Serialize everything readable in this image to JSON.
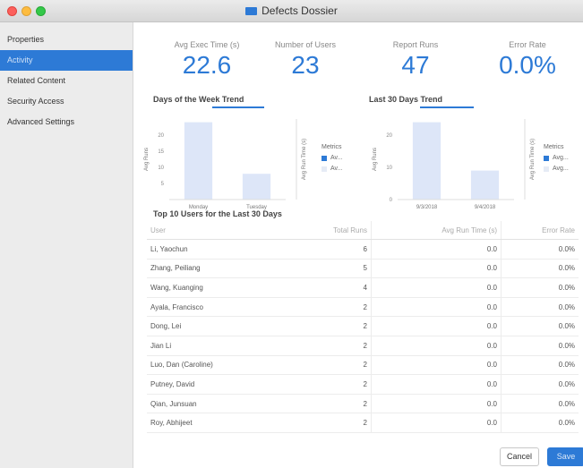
{
  "window": {
    "title": "Defects Dossier"
  },
  "sidebar": {
    "items": [
      {
        "label": "Properties"
      },
      {
        "label": "Activity"
      },
      {
        "label": "Related Content"
      },
      {
        "label": "Security Access"
      },
      {
        "label": "Advanced Settings"
      }
    ],
    "active_index": 1
  },
  "kpis": [
    {
      "label": "Avg Exec Time (s)",
      "value": "22.6"
    },
    {
      "label": "Number of Users",
      "value": "23"
    },
    {
      "label": "Report Runs",
      "value": "47"
    },
    {
      "label": "Error Rate",
      "value": "0.0%"
    }
  ],
  "charts": {
    "week": {
      "title": "Days of the Week Trend"
    },
    "days30": {
      "title": "Last 30 Days Trend"
    },
    "legend_title": "Metrics",
    "legend_items": [
      "Av...",
      "Av..."
    ],
    "legend_items_b": [
      "Avg...",
      "Avg..."
    ]
  },
  "chart_data": [
    {
      "type": "bar",
      "title": "Days of the Week Trend",
      "categories": [
        "Monday",
        "Tuesday"
      ],
      "series": [
        {
          "name": "Av...",
          "values": [
            24,
            8
          ]
        },
        {
          "name": "Av...",
          "values": [
            0,
            0
          ]
        }
      ],
      "ylabel": "Avg Runs",
      "y2label": "Avg Run Time (s)",
      "yticks": [
        "5",
        "10",
        "15",
        "20"
      ],
      "ylim": [
        0,
        25
      ]
    },
    {
      "type": "bar",
      "title": "Last 30 Days Trend",
      "categories": [
        "9/3/2018",
        "9/4/2018"
      ],
      "series": [
        {
          "name": "Avg...",
          "values": [
            24,
            9
          ]
        },
        {
          "name": "Avg...",
          "values": [
            0,
            0
          ]
        }
      ],
      "ylabel": "Avg Runs",
      "y2label": "Avg Run Time (s)",
      "yticks": [
        "0",
        "10",
        "20"
      ],
      "ylim": [
        0,
        25
      ]
    }
  ],
  "table": {
    "title": "Top 10 Users for the Last 30 Days",
    "headers": [
      "User",
      "Total Runs",
      "Avg Run Time (s)",
      "Error Rate"
    ],
    "rows": [
      [
        "Li, Yaochun",
        "6",
        "0.0",
        "0.0%"
      ],
      [
        "Zhang, Peiliang",
        "5",
        "0.0",
        "0.0%"
      ],
      [
        "Wang, Kuanging",
        "4",
        "0.0",
        "0.0%"
      ],
      [
        "Ayala, Francisco",
        "2",
        "0.0",
        "0.0%"
      ],
      [
        "Dong, Lei",
        "2",
        "0.0",
        "0.0%"
      ],
      [
        "Jian Li",
        "2",
        "0.0",
        "0.0%"
      ],
      [
        "Luo, Dan (Caroline)",
        "2",
        "0.0",
        "0.0%"
      ],
      [
        "Putney, David",
        "2",
        "0.0",
        "0.0%"
      ],
      [
        "Qian, Junsuan",
        "2",
        "0.0",
        "0.0%"
      ],
      [
        "Roy, Abhijeet",
        "2",
        "0.0",
        "0.0%"
      ]
    ]
  },
  "buttons": {
    "cancel": "Cancel",
    "save": "Save"
  },
  "colors": {
    "accent": "#2d7ad6",
    "bar": "#dde6f8",
    "bar_light": "#eef2fb"
  }
}
